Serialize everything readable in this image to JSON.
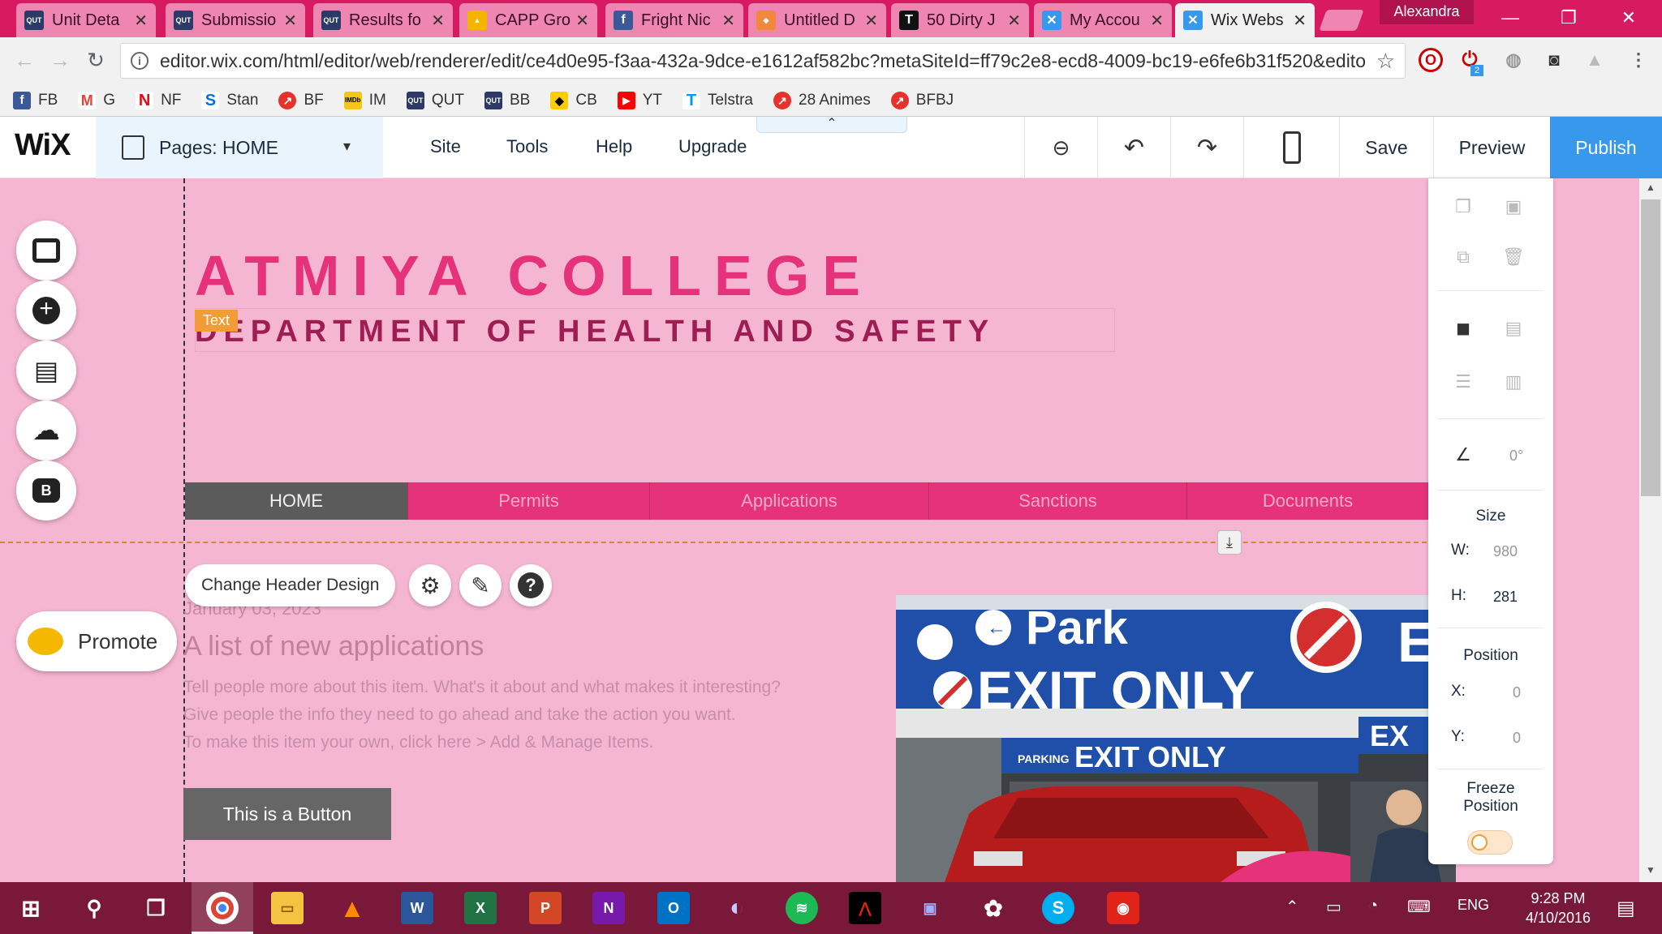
{
  "browser": {
    "tabs": [
      {
        "title": "Unit Deta",
        "icon": "qut-icon",
        "color": "#2b3a66"
      },
      {
        "title": "Submissio",
        "icon": "qut-icon",
        "color": "#2b3a66"
      },
      {
        "title": "Results fo",
        "icon": "qut-icon",
        "color": "#2b3a66"
      },
      {
        "title": "CAPP Gro",
        "icon": "google-drive-icon",
        "color": "#f4b400"
      },
      {
        "title": "Fright Nic",
        "icon": "facebook-icon",
        "color": "#3b5998"
      },
      {
        "title": "Untitled D",
        "icon": "wix-icon",
        "color": "#f0883e"
      },
      {
        "title": "50 Dirty J",
        "icon": "t-icon",
        "color": "#111111"
      },
      {
        "title": "My Accou",
        "icon": "wix-icon",
        "color": "#3899ec"
      },
      {
        "title": "Wix Webs",
        "icon": "wix-icon",
        "color": "#3899ec"
      }
    ],
    "profile_name": "Alexandra",
    "url": "editor.wix.com/html/editor/web/renderer/edit/ce4d0e95-f3aa-432a-9dce-e1612af582bc?metaSiteId=ff79c2e8-ecd8-4009-bc19-e6fe6b31f520&editorSe",
    "extension_badge": "2"
  },
  "bookmarks": [
    {
      "label": "FB",
      "color": "#3b5998",
      "glyph": "f"
    },
    {
      "label": "G",
      "color": "#ea4335",
      "glyph": "M"
    },
    {
      "label": "NF",
      "color": "#e50914",
      "glyph": "N"
    },
    {
      "label": "Stan",
      "color": "#0a6fd6",
      "glyph": "S"
    },
    {
      "label": "BF",
      "color": "#e7322b",
      "glyph": "↗"
    },
    {
      "label": "IM",
      "color": "#f5c518",
      "glyph": "IMDb"
    },
    {
      "label": "QUT",
      "color": "#2b3a66",
      "glyph": "QUT"
    },
    {
      "label": "BB",
      "color": "#2b3a66",
      "glyph": "QUT"
    },
    {
      "label": "CB",
      "color": "#ffcc00",
      "glyph": "◆"
    },
    {
      "label": "YT",
      "color": "#ff0000",
      "glyph": "▶"
    },
    {
      "label": "Telstra",
      "color": "#0099f8",
      "glyph": "T"
    },
    {
      "label": "28 Animes",
      "color": "#e7322b",
      "glyph": "↗"
    },
    {
      "label": "BFBJ",
      "color": "#e7322b",
      "glyph": "↗"
    }
  ],
  "wix_topbar": {
    "logo": "WiX",
    "pages_label": "Pages: HOME",
    "menu": [
      "Site",
      "Tools",
      "Help",
      "Upgrade"
    ],
    "save": "Save",
    "preview": "Preview",
    "publish": "Publish"
  },
  "site": {
    "title": "ATMIYA COLLEGE",
    "subtitle": "DEPARTMENT OF HEALTH AND SAFETY",
    "selection_tag": "Text",
    "nav": [
      {
        "label": "HOME",
        "active": true
      },
      {
        "label": "Permits",
        "active": false
      },
      {
        "label": "Applications",
        "active": false
      },
      {
        "label": "Sanctions",
        "active": false
      },
      {
        "label": "Documents",
        "active": false
      }
    ],
    "change_header": "Change Header Design",
    "item": {
      "date": "January 03, 2023",
      "title": "A list of new applications",
      "desc_lines": [
        "Tell people more about this item. What's it about and what makes it interesting?",
        "Give people the info they need to go ahead and take the action you want.",
        "To make this item your own, click here > Add & Manage Items."
      ],
      "button": "This is a Button"
    },
    "photo_signs": {
      "park": "Park",
      "exit_only": "EXIT ONLY",
      "exit_only_2": "EXIT ONLY",
      "parking": "PARKING",
      "ex": "EX",
      "e": "E"
    }
  },
  "left_panel": {
    "promote": "Promote",
    "blog_letter": "B"
  },
  "inspector": {
    "rotation": "0°",
    "size_label": "Size",
    "w_key": "W:",
    "w_val": "980",
    "h_key": "H:",
    "h_val": "281",
    "position_label": "Position",
    "x_key": "X:",
    "x_val": "0",
    "y_key": "Y:",
    "y_val": "0",
    "freeze_label_1": "Freeze",
    "freeze_label_2": "Position",
    "freeze_on": false
  },
  "taskbar": {
    "time": "9:28 PM",
    "date": "4/10/2016",
    "lang": "ENG"
  },
  "colors": {
    "canvas_bg": "#f5b6d2",
    "accent_pink": "#e5327a",
    "publish_blue": "#3899ec",
    "tab_strip": "#d81b60",
    "taskbar": "#7a1839"
  }
}
